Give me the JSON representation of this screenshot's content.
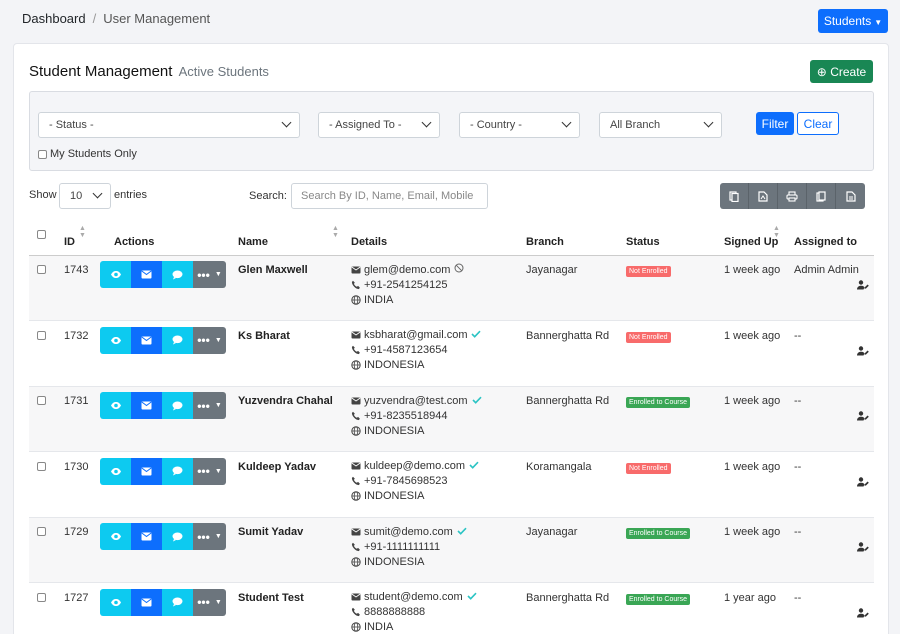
{
  "breadcrumb": {
    "root": "Dashboard",
    "separator": "/",
    "current": "User Management"
  },
  "header_button": {
    "label": "Students"
  },
  "card": {
    "title": "Student Management",
    "subtitle": "Active Students",
    "create_label": "Create"
  },
  "filters": {
    "status": "- Status -",
    "assigned_to": "- Assigned To -",
    "country": "- Country -",
    "branch": "All Branch",
    "filter_label": "Filter",
    "clear_label": "Clear",
    "my_students_label": "My Students Only"
  },
  "table_controls": {
    "show_label": "Show",
    "entries_value": "10",
    "entries_label": "entries",
    "search_label": "Search:",
    "search_placeholder": "Search By ID, Name, Email, Mobile"
  },
  "columns": [
    "ID",
    "Actions",
    "Name",
    "Details",
    "Branch",
    "Status",
    "Signed Up",
    "Assigned to"
  ],
  "rows": [
    {
      "id": "1743",
      "name": "Glen Maxwell",
      "email": "glem@demo.com",
      "verified": false,
      "phone": "+91-2541254125",
      "country": "INDIA",
      "branch": "Jayanagar",
      "status": "Not Enrolled",
      "status_color": "#f86b6b",
      "signed_up": "1 week ago",
      "assigned": "Admin Admin"
    },
    {
      "id": "1732",
      "name": "Ks Bharat",
      "email": "ksbharat@gmail.com",
      "verified": true,
      "phone": "+91-4587123654",
      "country": "INDONESIA",
      "branch": "Bannerghatta Rd",
      "status": "Not Enrolled",
      "status_color": "#f86b6b",
      "signed_up": "1 week ago",
      "assigned": "--"
    },
    {
      "id": "1731",
      "name": "Yuzvendra Chahal",
      "email": "yuzvendra@test.com",
      "verified": true,
      "phone": "+91-8235518944",
      "country": "INDONESIA",
      "branch": "Bannerghatta Rd",
      "status": "Enrolled to Course",
      "status_color": "#3aa655",
      "signed_up": "1 week ago",
      "assigned": "--"
    },
    {
      "id": "1730",
      "name": "Kuldeep Yadav",
      "email": "kuldeep@demo.com",
      "verified": true,
      "phone": "+91-7845698523",
      "country": "INDONESIA",
      "branch": "Koramangala",
      "status": "Not Enrolled",
      "status_color": "#f86b6b",
      "signed_up": "1 week ago",
      "assigned": "--"
    },
    {
      "id": "1729",
      "name": "Sumit Yadav",
      "email": "sumit@demo.com",
      "verified": true,
      "phone": "+91-1111111111",
      "country": "INDONESIA",
      "branch": "Jayanagar",
      "status": "Enrolled to Course",
      "status_color": "#3aa655",
      "signed_up": "1 week ago",
      "assigned": "--"
    },
    {
      "id": "1727",
      "name": "Student Test",
      "email": "student@demo.com",
      "verified": true,
      "phone": "8888888888",
      "country": "INDIA",
      "branch": "Bannerghatta Rd",
      "status": "Enrolled to Course",
      "status_color": "#3aa655",
      "signed_up": "1 year ago",
      "assigned": "--"
    }
  ],
  "icons": {
    "view": "eye-icon",
    "mail": "envelope-icon",
    "chat": "chat-bubble-icon",
    "more": "ellipsis-icon",
    "email": "envelope-icon",
    "phone": "phone-icon",
    "country": "globe-icon",
    "verified": "check-icon",
    "unverified": "ban-icon",
    "assign": "user-edit-icon"
  }
}
